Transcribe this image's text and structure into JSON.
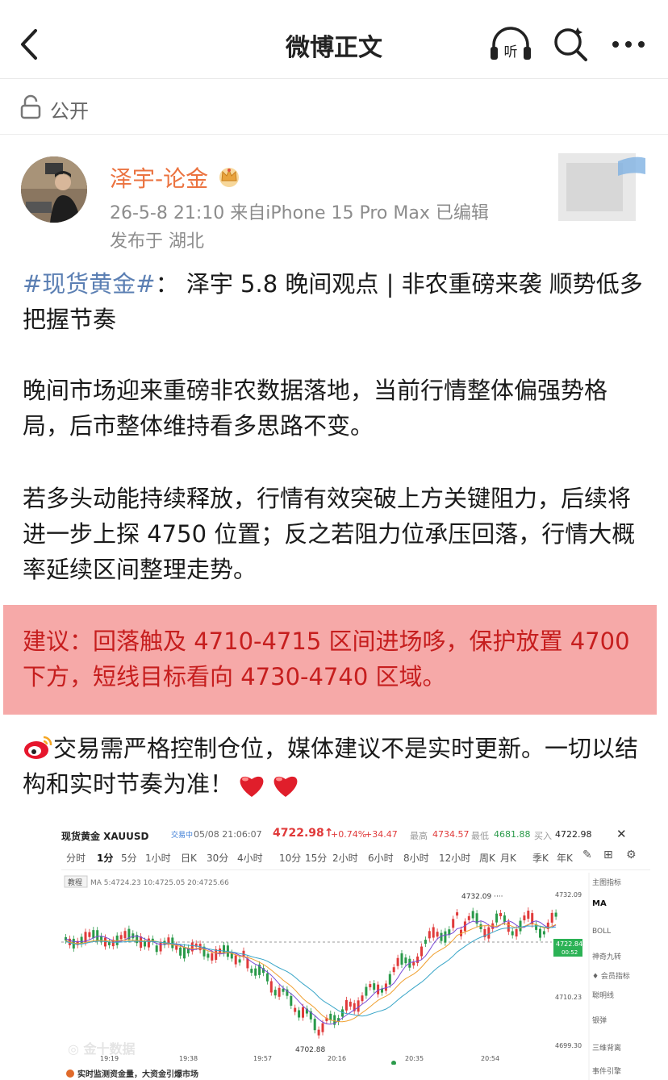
{
  "nav": {
    "title": "微博正文",
    "listen_label": "听"
  },
  "visibility": {
    "label": "公开"
  },
  "author": {
    "name": "泽宇-论金",
    "meta": "26-5-8 21:10  来自iPhone 15 Pro Max  已编辑",
    "location": "发布于 湖北"
  },
  "post": {
    "hashtag": "#现货黄金#",
    "title_rest": "：  泽宇 5.8 晚间观点 | 非农重磅来袭 顺势低多把握节奏",
    "para1": "晚间市场迎来重磅非农数据落地，当前行情整体偏强势格局，后市整体维持看多思路不变。",
    "para2": "若多头动能持续释放，行情有效突破上方关键阻力，后续将进一步上探 4750 位置；反之若阻力位承压回落，行情大概率延续区间整理走势。",
    "suggestion": "建议：回落触及 4710-4715 区间进场哆，保护放置 4700 下方，短线目标看向 4730-4740 区域。",
    "para4": "交易需严格控制仓位，媒体建议不是实时更新。一切以结构和实时节奏为准！"
  },
  "colors": {
    "author": "#eb7340",
    "hashtag": "#5b7fb3",
    "highlight_bg": "#f6a9a8",
    "highlight_text": "#c61e1e"
  },
  "chart_shot": {
    "symbol": "现货黄金 XAUUSD",
    "status": "交易中",
    "time": "05/08 21:06:07",
    "price": "4722.98↑",
    "change_pct": "+0.74%",
    "change": "+34.47",
    "high_label": "最高",
    "high": "4734.57",
    "low_label": "最低",
    "low": "4681.88",
    "buy_label": "买入",
    "buy": "4722.98",
    "intervals": [
      "分时",
      "1分",
      "5分",
      "1小时",
      "日K",
      "30分",
      "4小时",
      "10分",
      "15分",
      "2小时",
      "6小时",
      "8小时",
      "12小时",
      "周K",
      "月K",
      "季K",
      "年K"
    ],
    "tutorial": "教程",
    "ma_line": "MA 5:4724.23 10:4725.05 20:4725.66",
    "side_panel": [
      "主图指标",
      "MA",
      "BOLL",
      "神奇九转",
      "会员指标",
      "聪明线",
      "银弹",
      "三维背离",
      "事件引擎"
    ],
    "price_labels": [
      "4732.09",
      "4722.84",
      "00:52",
      "4710.23",
      "4699.30"
    ],
    "peak_label": "4732.09",
    "trough_label": "4702.88",
    "time_ticks": [
      "19:19",
      "19:38",
      "19:57",
      "20:16",
      "20:35",
      "20:54"
    ],
    "watermark": "金十数据",
    "footer": "实时监测资金量，大资金引爆市场"
  }
}
